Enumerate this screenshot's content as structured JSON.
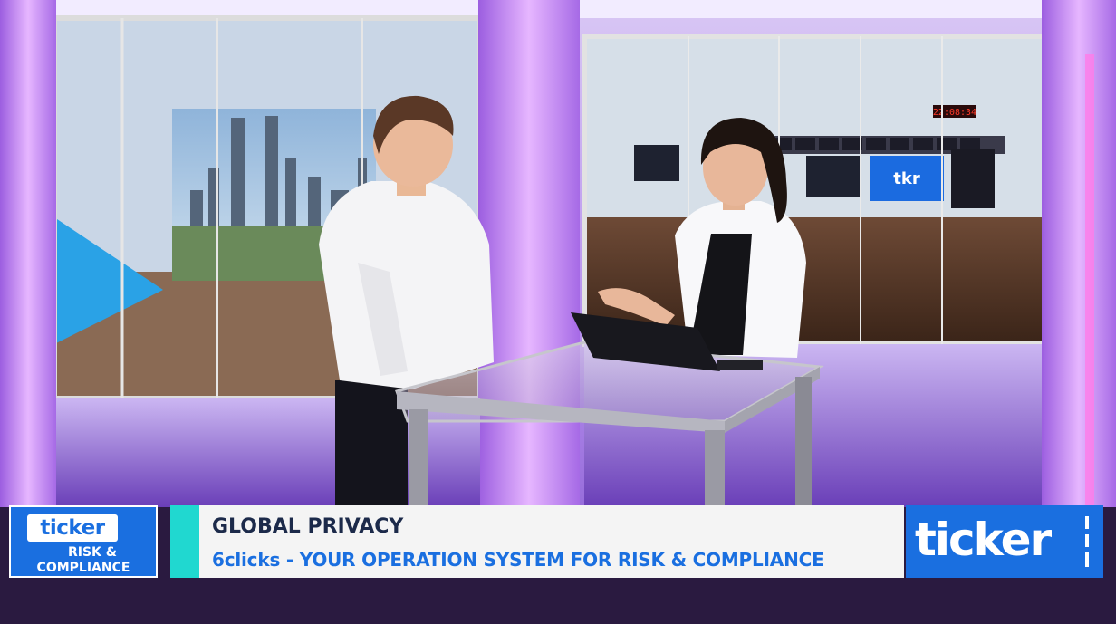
{
  "show_badge": {
    "brand": "ticker",
    "line1": "RISK &",
    "line2": "COMPLIANCE"
  },
  "headline": {
    "title": "GLOBAL PRIVACY",
    "subtitle": "6clicks - YOUR OPERATION SYSTEM FOR RISK & COMPLIANCE"
  },
  "brand_logo": {
    "word": "ticker"
  },
  "studio": {
    "screen_logo": "tkr",
    "clock": "22:08:34"
  },
  "colors": {
    "brand_blue": "#1a6fe0",
    "accent_teal": "#20d8d0",
    "headline_navy": "#1c2a4a",
    "studio_purple": "#b46be8"
  }
}
